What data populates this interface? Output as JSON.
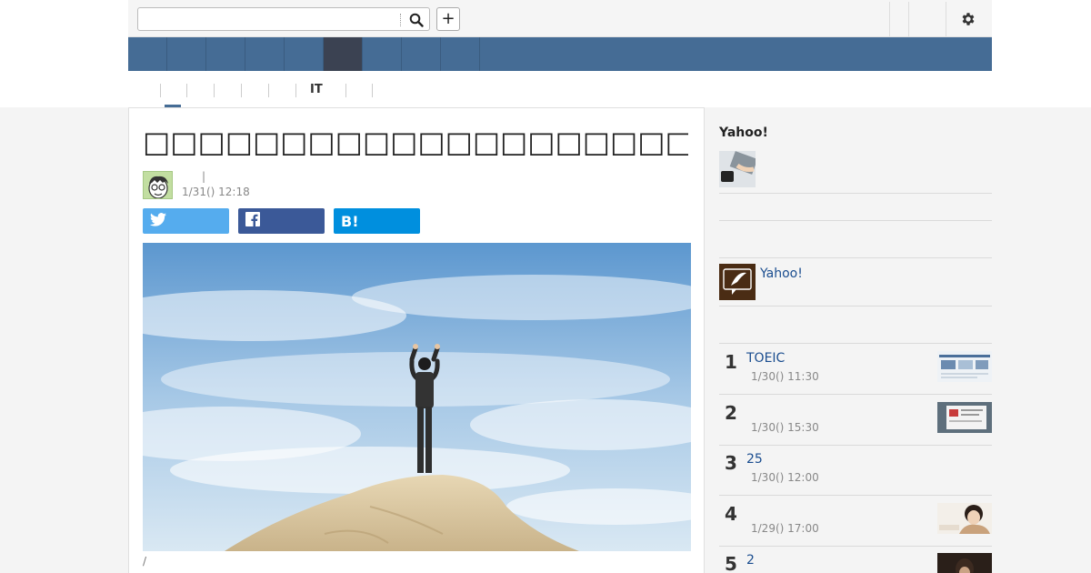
{
  "search": {
    "placeholder": "",
    "value": ""
  },
  "topbar": {
    "plus_label": "+"
  },
  "nav": {
    "items": [
      "",
      "",
      "",
      "",
      "",
      "",
      "",
      "",
      ""
    ],
    "active_index": 5
  },
  "subnav": {
    "items": [
      "",
      "",
      "",
      "",
      "IT",
      ""
    ]
  },
  "article": {
    "title": "□□□□□□□□□□□□□□□□□□□□□□□□□□□□□□□□□□□□□□□□□□□□",
    "author": "",
    "author_sep": "|",
    "date": "1/31() 12:18",
    "caption": "/"
  },
  "share": {
    "twitter_icon": "twitter-icon",
    "facebook_icon": "facebook-icon",
    "hatena_label": "B!"
  },
  "sidebar": {
    "title": "Yahoo!",
    "yahoo_link": "Yahoo!",
    "ranking": [
      {
        "rank": "1",
        "title": "TOEIC",
        "date": "1/30() 11:30"
      },
      {
        "rank": "2",
        "title": "",
        "date": "1/30() 15:30"
      },
      {
        "rank": "3",
        "title": "25",
        "date": "1/30() 12:00"
      },
      {
        "rank": "4",
        "title": "",
        "date": "1/29() 17:00"
      },
      {
        "rank": "5",
        "title": "2",
        "date": ""
      }
    ]
  },
  "colors": {
    "nav_blue": "#456c95",
    "nav_active": "#3b4252",
    "link": "#1a4d8f",
    "twitter": "#55acee",
    "facebook": "#3b5998",
    "hatena": "#008fde"
  }
}
